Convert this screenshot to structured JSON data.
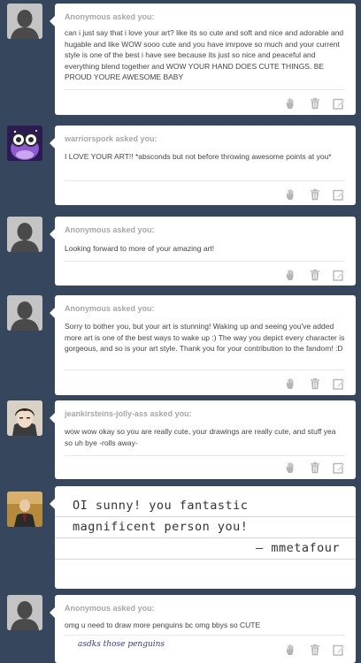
{
  "asks": [
    {
      "asker": "Anonymous asked you:",
      "avatar": "anonymous-silhouette",
      "question": "can i just say that i love your art? like its so cute and soft and nice and adorable and hugable and like WOW sooo cute and you have imrpove so much and your current style is one of the best i have see because its just so nice and peaceful and everything blend together and WOW YOUR HAND DOES CUTE THINGS. BE PROUD YOURE AWESOME BABY"
    },
    {
      "asker": "warriorspork asked you:",
      "avatar": "purple-cartoon-avatar",
      "question": "I LOVE YOUR ART!! *absconds but not before throwing awesome points at you*"
    },
    {
      "asker": "Anonymous asked you:",
      "avatar": "anonymous-silhouette",
      "question": "Looking forward to more of your amazing art!"
    },
    {
      "asker": "Anonymous asked you:",
      "avatar": "anonymous-silhouette",
      "question": "Sorry to bother you, but your art is stunning! Waking up and seeing you've added more art is one of the best ways to wake up :) The way you depict every character is gorgeous, and so is your art style. Thank you for your contribution to the fandom! :D"
    },
    {
      "asker": "jeankirsteins-jolly-ass asked you:",
      "avatar": "anime-character-avatar",
      "question": "wow wow okay so you are really cute, your drawings are really cute, and stuff yea so uh bye -rolls away-"
    },
    {
      "asker": "",
      "avatar": "photo-avatar",
      "note_lines": [
        "OI sunny! you fantastic",
        "magnificent person you!",
        "— mmetafour"
      ]
    },
    {
      "asker": "Anonymous asked you:",
      "avatar": "anonymous-silhouette",
      "question": "omg u need to draw more penguins bc omg bbys so CUTE",
      "handwritten": "asdks those penguins"
    }
  ],
  "action_icons": [
    "hand-icon",
    "trash-icon",
    "edit-icon"
  ],
  "colors": {
    "dashboard_bg": "#36465d",
    "card_bg": "#ffffff",
    "asker_text": "#a7a7a7",
    "body_text": "#444444",
    "icon_color": "#b5b5b5"
  }
}
